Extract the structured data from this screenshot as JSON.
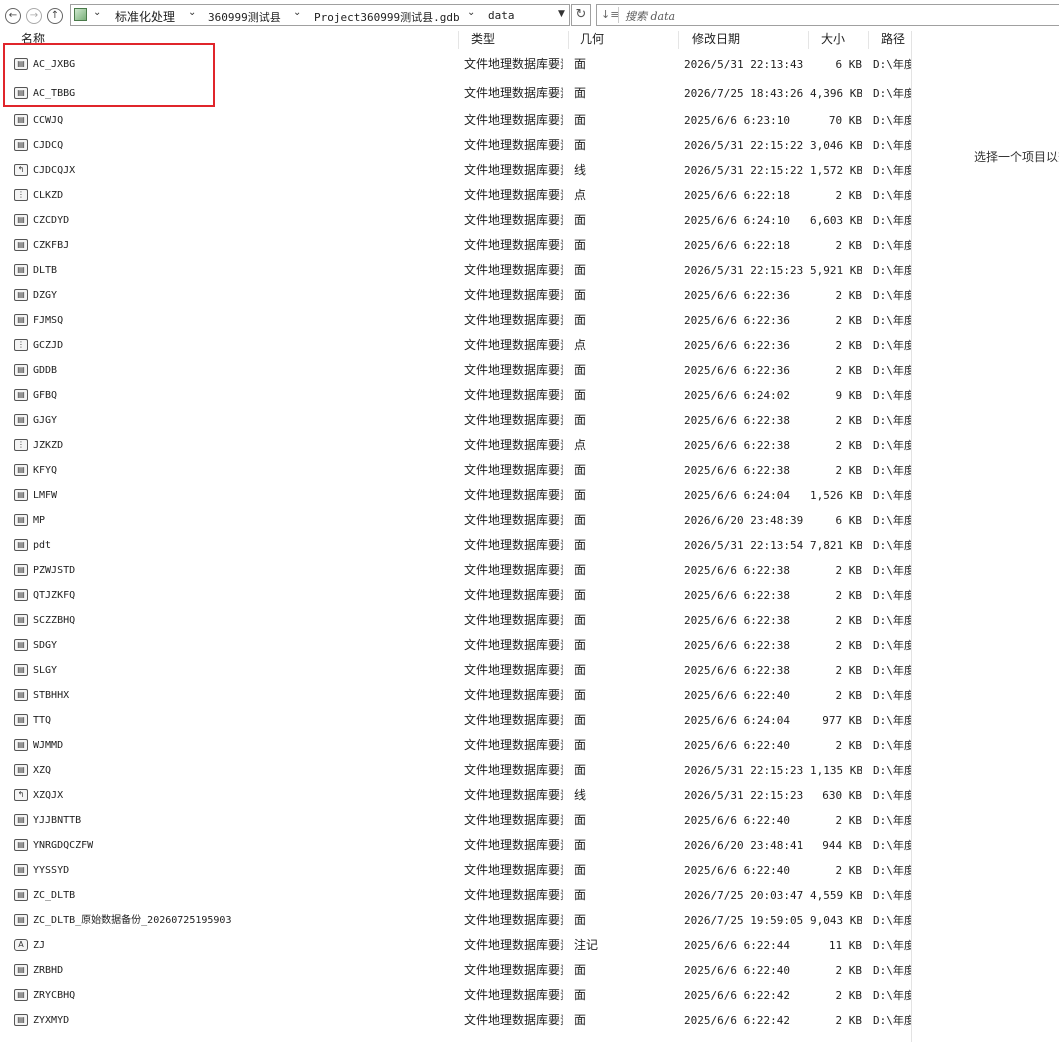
{
  "toolbar": {
    "back_glyph": "←",
    "forward_glyph": "→",
    "up_glyph": "↑",
    "breadcrumb": [
      "标准化处理",
      "360999测试县",
      "Project360999测试县.gdb",
      "data"
    ],
    "refresh_glyph": "↻",
    "search_placeholder": "搜索 data"
  },
  "columns": {
    "name": "名称",
    "type": "类型",
    "geometry": "几何",
    "date": "修改日期",
    "size": "大小",
    "path": "路径"
  },
  "preview_text": "选择一个项目以查看",
  "icons": {
    "polygon": "▤",
    "line": "↰",
    "point": "⋮",
    "annotation": "A"
  },
  "files": [
    {
      "name": "AC_JXBG",
      "type": "文件地理数据库要素类",
      "geom": "面",
      "date": "2026/5/31 22:13:43",
      "size": "6 KB",
      "path": "D:\\年度",
      "icon": "polygon"
    },
    {
      "name": "AC_TBBG",
      "type": "文件地理数据库要素类",
      "geom": "面",
      "date": "2026/7/25 18:43:26",
      "size": "4,396 KB",
      "path": "D:\\年度",
      "icon": "polygon"
    },
    {
      "name": "CCWJQ",
      "type": "文件地理数据库要素类",
      "geom": "面",
      "date": "2025/6/6 6:23:10",
      "size": "70 KB",
      "path": "D:\\年度",
      "icon": "polygon"
    },
    {
      "name": "CJDCQ",
      "type": "文件地理数据库要素类",
      "geom": "面",
      "date": "2026/5/31 22:15:22",
      "size": "3,046 KB",
      "path": "D:\\年度",
      "icon": "polygon"
    },
    {
      "name": "CJDCQJX",
      "type": "文件地理数据库要素类",
      "geom": "线",
      "date": "2026/5/31 22:15:22",
      "size": "1,572 KB",
      "path": "D:\\年度",
      "icon": "line"
    },
    {
      "name": "CLKZD",
      "type": "文件地理数据库要素类",
      "geom": "点",
      "date": "2025/6/6 6:22:18",
      "size": "2 KB",
      "path": "D:\\年度",
      "icon": "point"
    },
    {
      "name": "CZCDYD",
      "type": "文件地理数据库要素类",
      "geom": "面",
      "date": "2025/6/6 6:24:10",
      "size": "6,603 KB",
      "path": "D:\\年度",
      "icon": "polygon"
    },
    {
      "name": "CZKFBJ",
      "type": "文件地理数据库要素类",
      "geom": "面",
      "date": "2025/6/6 6:22:18",
      "size": "2 KB",
      "path": "D:\\年度",
      "icon": "polygon"
    },
    {
      "name": "DLTB",
      "type": "文件地理数据库要素类",
      "geom": "面",
      "date": "2026/5/31 22:15:23",
      "size": "5,921 KB",
      "path": "D:\\年度",
      "icon": "polygon"
    },
    {
      "name": "DZGY",
      "type": "文件地理数据库要素类",
      "geom": "面",
      "date": "2025/6/6 6:22:36",
      "size": "2 KB",
      "path": "D:\\年度",
      "icon": "polygon"
    },
    {
      "name": "FJMSQ",
      "type": "文件地理数据库要素类",
      "geom": "面",
      "date": "2025/6/6 6:22:36",
      "size": "2 KB",
      "path": "D:\\年度",
      "icon": "polygon"
    },
    {
      "name": "GCZJD",
      "type": "文件地理数据库要素类",
      "geom": "点",
      "date": "2025/6/6 6:22:36",
      "size": "2 KB",
      "path": "D:\\年度",
      "icon": "point"
    },
    {
      "name": "GDDB",
      "type": "文件地理数据库要素类",
      "geom": "面",
      "date": "2025/6/6 6:22:36",
      "size": "2 KB",
      "path": "D:\\年度",
      "icon": "polygon"
    },
    {
      "name": "GFBQ",
      "type": "文件地理数据库要素类",
      "geom": "面",
      "date": "2025/6/6 6:24:02",
      "size": "9 KB",
      "path": "D:\\年度",
      "icon": "polygon"
    },
    {
      "name": "GJGY",
      "type": "文件地理数据库要素类",
      "geom": "面",
      "date": "2025/6/6 6:22:38",
      "size": "2 KB",
      "path": "D:\\年度",
      "icon": "polygon"
    },
    {
      "name": "JZKZD",
      "type": "文件地理数据库要素类",
      "geom": "点",
      "date": "2025/6/6 6:22:38",
      "size": "2 KB",
      "path": "D:\\年度",
      "icon": "point"
    },
    {
      "name": "KFYQ",
      "type": "文件地理数据库要素类",
      "geom": "面",
      "date": "2025/6/6 6:22:38",
      "size": "2 KB",
      "path": "D:\\年度",
      "icon": "polygon"
    },
    {
      "name": "LMFW",
      "type": "文件地理数据库要素类",
      "geom": "面",
      "date": "2025/6/6 6:24:04",
      "size": "1,526 KB",
      "path": "D:\\年度",
      "icon": "polygon"
    },
    {
      "name": "MP",
      "type": "文件地理数据库要素类",
      "geom": "面",
      "date": "2026/6/20 23:48:39",
      "size": "6 KB",
      "path": "D:\\年度",
      "icon": "polygon"
    },
    {
      "name": "pdt",
      "type": "文件地理数据库要素类",
      "geom": "面",
      "date": "2026/5/31 22:13:54",
      "size": "7,821 KB",
      "path": "D:\\年度",
      "icon": "polygon"
    },
    {
      "name": "PZWJSTD",
      "type": "文件地理数据库要素类",
      "geom": "面",
      "date": "2025/6/6 6:22:38",
      "size": "2 KB",
      "path": "D:\\年度",
      "icon": "polygon"
    },
    {
      "name": "QTJZKFQ",
      "type": "文件地理数据库要素类",
      "geom": "面",
      "date": "2025/6/6 6:22:38",
      "size": "2 KB",
      "path": "D:\\年度",
      "icon": "polygon"
    },
    {
      "name": "SCZZBHQ",
      "type": "文件地理数据库要素类",
      "geom": "面",
      "date": "2025/6/6 6:22:38",
      "size": "2 KB",
      "path": "D:\\年度",
      "icon": "polygon"
    },
    {
      "name": "SDGY",
      "type": "文件地理数据库要素类",
      "geom": "面",
      "date": "2025/6/6 6:22:38",
      "size": "2 KB",
      "path": "D:\\年度",
      "icon": "polygon"
    },
    {
      "name": "SLGY",
      "type": "文件地理数据库要素类",
      "geom": "面",
      "date": "2025/6/6 6:22:38",
      "size": "2 KB",
      "path": "D:\\年度",
      "icon": "polygon"
    },
    {
      "name": "STBHHX",
      "type": "文件地理数据库要素类",
      "geom": "面",
      "date": "2025/6/6 6:22:40",
      "size": "2 KB",
      "path": "D:\\年度",
      "icon": "polygon"
    },
    {
      "name": "TTQ",
      "type": "文件地理数据库要素类",
      "geom": "面",
      "date": "2025/6/6 6:24:04",
      "size": "977 KB",
      "path": "D:\\年度",
      "icon": "polygon"
    },
    {
      "name": "WJMMD",
      "type": "文件地理数据库要素类",
      "geom": "面",
      "date": "2025/6/6 6:22:40",
      "size": "2 KB",
      "path": "D:\\年度",
      "icon": "polygon"
    },
    {
      "name": "XZQ",
      "type": "文件地理数据库要素类",
      "geom": "面",
      "date": "2026/5/31 22:15:23",
      "size": "1,135 KB",
      "path": "D:\\年度",
      "icon": "polygon"
    },
    {
      "name": "XZQJX",
      "type": "文件地理数据库要素类",
      "geom": "线",
      "date": "2026/5/31 22:15:23",
      "size": "630 KB",
      "path": "D:\\年度",
      "icon": "line"
    },
    {
      "name": "YJJBNTTB",
      "type": "文件地理数据库要素类",
      "geom": "面",
      "date": "2025/6/6 6:22:40",
      "size": "2 KB",
      "path": "D:\\年度",
      "icon": "polygon"
    },
    {
      "name": "YNRGDQCZFW",
      "type": "文件地理数据库要素类",
      "geom": "面",
      "date": "2026/6/20 23:48:41",
      "size": "944 KB",
      "path": "D:\\年度",
      "icon": "polygon"
    },
    {
      "name": "YYSSYD",
      "type": "文件地理数据库要素类",
      "geom": "面",
      "date": "2025/6/6 6:22:40",
      "size": "2 KB",
      "path": "D:\\年度",
      "icon": "polygon"
    },
    {
      "name": "ZC_DLTB",
      "type": "文件地理数据库要素类",
      "geom": "面",
      "date": "2026/7/25 20:03:47",
      "size": "4,559 KB",
      "path": "D:\\年度",
      "icon": "polygon"
    },
    {
      "name": "ZC_DLTB_原始数据备份_20260725195903",
      "type": "文件地理数据库要素类",
      "geom": "面",
      "date": "2026/7/25 19:59:05",
      "size": "9,043 KB",
      "path": "D:\\年度",
      "icon": "polygon"
    },
    {
      "name": "ZJ",
      "type": "文件地理数据库要素类",
      "geom": "注记",
      "date": "2025/6/6 6:22:44",
      "size": "11 KB",
      "path": "D:\\年度",
      "icon": "annotation"
    },
    {
      "name": "ZRBHD",
      "type": "文件地理数据库要素类",
      "geom": "面",
      "date": "2025/6/6 6:22:40",
      "size": "2 KB",
      "path": "D:\\年度",
      "icon": "polygon"
    },
    {
      "name": "ZRYCBHQ",
      "type": "文件地理数据库要素类",
      "geom": "面",
      "date": "2025/6/6 6:22:42",
      "size": "2 KB",
      "path": "D:\\年度",
      "icon": "polygon"
    },
    {
      "name": "ZYXMYD",
      "type": "文件地理数据库要素类",
      "geom": "面",
      "date": "2025/6/6 6:22:42",
      "size": "2 KB",
      "path": "D:\\年度",
      "icon": "polygon"
    }
  ]
}
